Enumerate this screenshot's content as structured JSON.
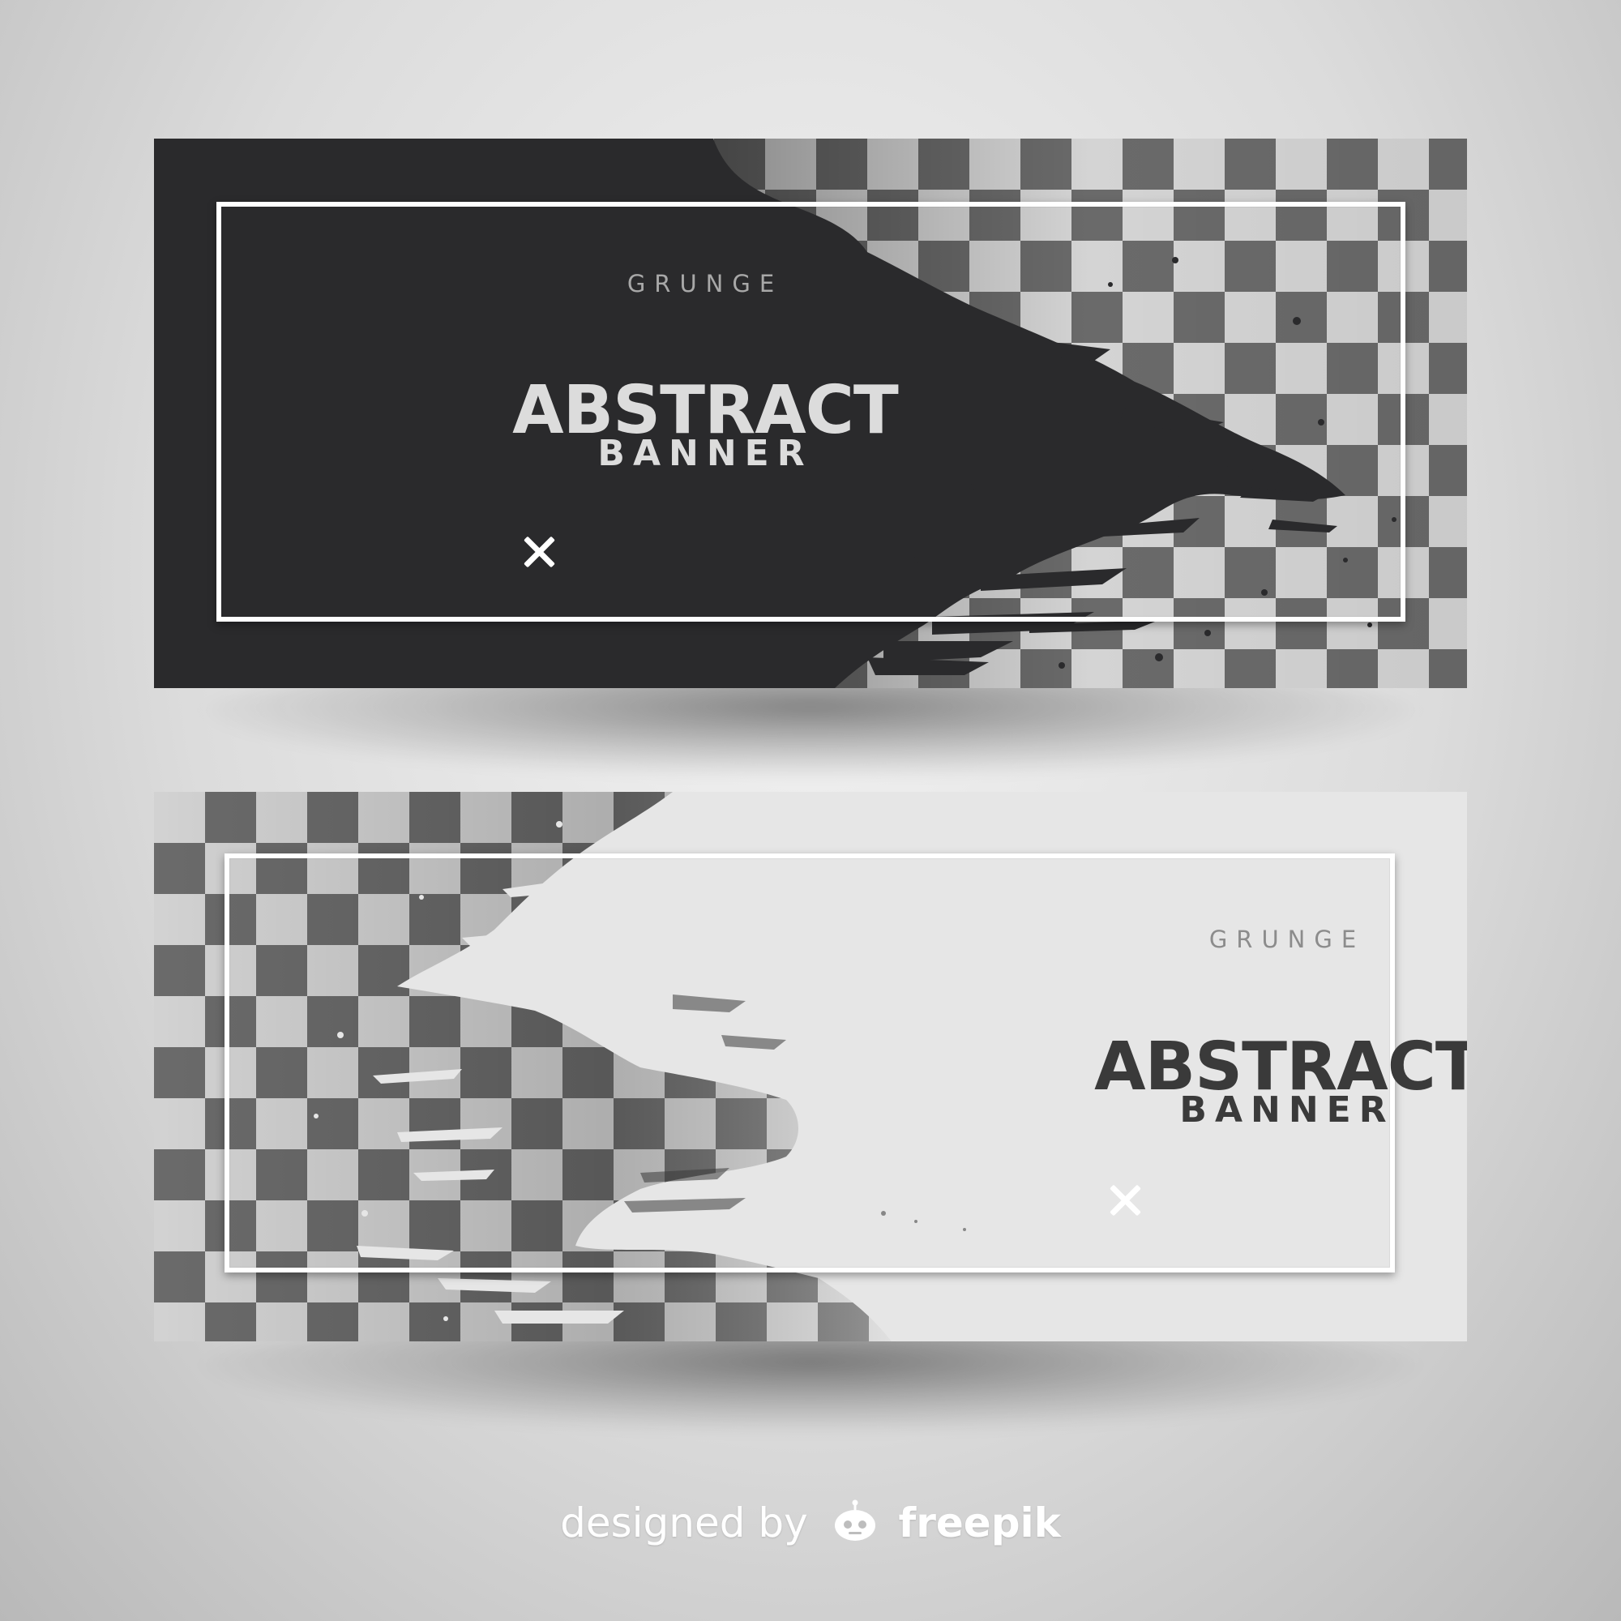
{
  "banners": [
    {
      "theme": "dark",
      "kicker": "GRUNGE",
      "headline": "ABSTRACT",
      "subheadline": "BANNER",
      "close_icon": "close-icon",
      "colors": {
        "background": "#2a2a2c",
        "checker_light": "#d4d4d4",
        "checker_dark": "#6a6a6a",
        "frame": "#ffffff"
      }
    },
    {
      "theme": "light",
      "kicker": "GRUNGE",
      "headline": "ABSTRACT",
      "subheadline": "BANNER",
      "close_icon": "close-icon",
      "colors": {
        "background": "#dcdcdc",
        "checker_light": "#d9d9d9",
        "checker_dark": "#6e6e6e",
        "frame": "#ffffff"
      }
    }
  ],
  "credit": {
    "prefix": "designed by",
    "brand": "freepik",
    "logo_icon": "freepik-logo-icon"
  }
}
